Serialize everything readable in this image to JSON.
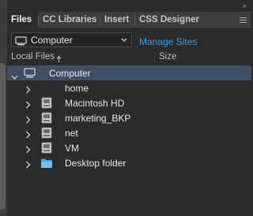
{
  "tabs": [
    {
      "label": "Files",
      "active": true
    },
    {
      "label": "CC Libraries",
      "active": false
    },
    {
      "label": "Insert",
      "active": false
    },
    {
      "label": "CSS Designer",
      "active": false
    }
  ],
  "site_select": {
    "value": "Computer"
  },
  "manage_sites_label": "Manage Sites",
  "columns": {
    "local_files": "Local Files",
    "size": "Size"
  },
  "tree": {
    "root": {
      "label": "Computer",
      "icon": "monitor-icon",
      "expanded": true,
      "selected": true
    },
    "items": [
      {
        "label": "home",
        "icon": "none"
      },
      {
        "label": "Macintosh HD",
        "icon": "drive-icon"
      },
      {
        "label": "marketing_BKP",
        "icon": "drive-icon"
      },
      {
        "label": "net",
        "icon": "drive-icon"
      },
      {
        "label": "VM",
        "icon": "drive-icon"
      },
      {
        "label": "Desktop folder",
        "icon": "folder-icon"
      }
    ]
  },
  "colors": {
    "background": "#2b2b2b",
    "tab_bar": "#3d3d3d",
    "selection": "#3e4f63",
    "link": "#3d9bdc",
    "folder": "#4aa8e8"
  }
}
